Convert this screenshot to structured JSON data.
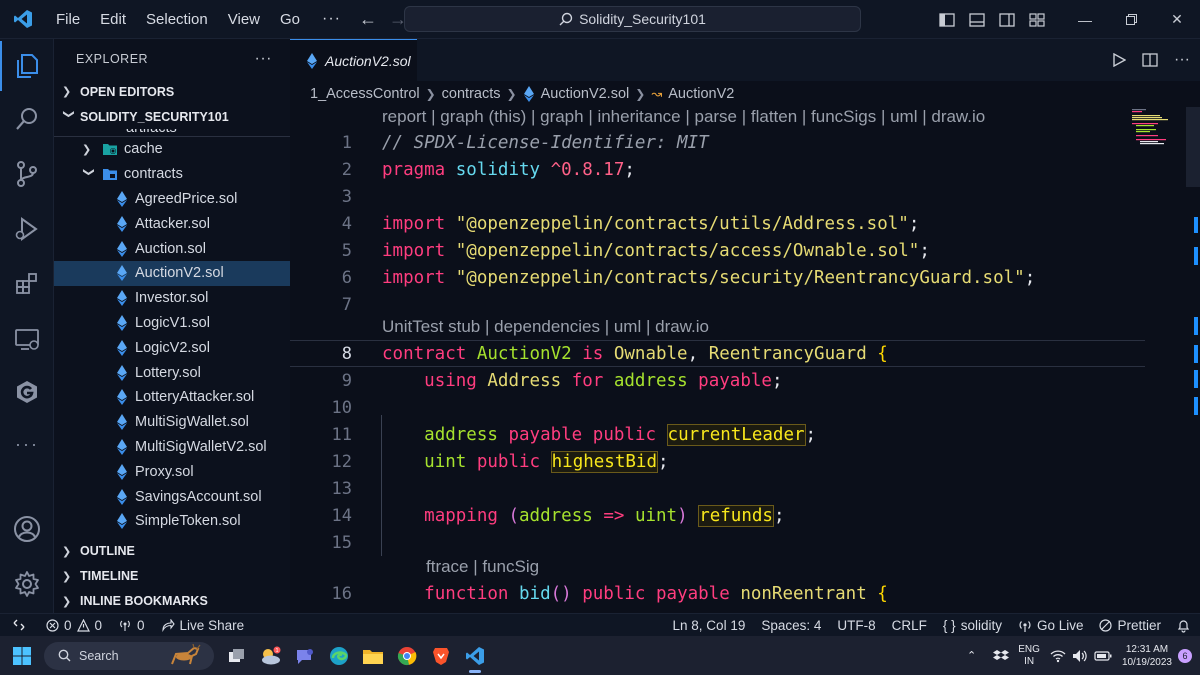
{
  "titlebar": {
    "menu": [
      "File",
      "Edit",
      "Selection",
      "View",
      "Go"
    ],
    "more": "···",
    "search_text": "Solidity_Security101"
  },
  "sidebar": {
    "title": "EXPLORER",
    "more": "···",
    "open_editors": "OPEN EDITORS",
    "project": "SOLIDITY_SECURITY101",
    "partial_folder": "artifacts",
    "folders": [
      {
        "label": "cache",
        "expanded": false
      },
      {
        "label": "contracts",
        "expanded": true
      }
    ],
    "files": [
      "AgreedPrice.sol",
      "Attacker.sol",
      "Auction.sol",
      "AuctionV2.sol",
      "Investor.sol",
      "LogicV1.sol",
      "LogicV2.sol",
      "Lottery.sol",
      "LotteryAttacker.sol",
      "MultiSigWallet.sol",
      "MultiSigWalletV2.sol",
      "Proxy.sol",
      "SavingsAccount.sol",
      "SimpleToken.sol"
    ],
    "selected_file": "AuctionV2.sol",
    "outline": "OUTLINE",
    "timeline": "TIMELINE",
    "bookmarks": "INLINE BOOKMARKS"
  },
  "editor": {
    "tab": "AuctionV2.sol",
    "breadcrumb": [
      "1_AccessControl",
      "contracts",
      "AuctionV2.sol",
      "AuctionV2"
    ],
    "lens_top": "report | graph (this) | graph | inheritance | parse | flatten | funcSigs | uml | draw.io",
    "lens_contract": "UnitTest stub | dependencies | uml | draw.io",
    "lens_func": "ftrace | funcSig",
    "line_numbers": [
      "1",
      "2",
      "3",
      "4",
      "5",
      "6",
      "7",
      "8",
      "9",
      "10",
      "11",
      "12",
      "13",
      "14",
      "15",
      "16"
    ],
    "current_line": "8",
    "code": {
      "l1": "// SPDX-License-Identifier: MIT",
      "l2_kw": "pragma",
      "l2_name": "solidity",
      "l2_ver": "^0.8.17",
      "l2_end": ";",
      "import_kw": "import",
      "l4_str": "\"@openzeppelin/contracts/utils/Address.sol\"",
      "l5_str": "\"@openzeppelin/contracts/access/Ownable.sol\"",
      "l6_str": "\"@openzeppelin/contracts/security/ReentrancyGuard.sol\"",
      "semi": ";",
      "l8_kw": "contract",
      "l8_name": "AuctionV2",
      "l8_is": "is",
      "l8_base1": "Ownable",
      "l8_comma": ",",
      "l8_base2": "ReentrancyGuard",
      "l8_brace": "{",
      "l9_using": "using",
      "l9_lib": "Address",
      "l9_for": "for",
      "l9_type": "address",
      "l9_payable": "payable",
      "l11_type": "address",
      "l11_payable": "payable",
      "l11_public": "public",
      "l11_var": "currentLeader",
      "l12_type": "uint",
      "l12_public": "public",
      "l12_var": "highestBid",
      "l14_mapping": "mapping",
      "l14_open": "(",
      "l14_k": "address",
      "l14_arrow": "=>",
      "l14_v": "uint",
      "l14_close": ")",
      "l14_var": "refunds",
      "l16_fn": "function",
      "l16_name": "bid",
      "l16_parens": "()",
      "l16_public": "public",
      "l16_payable": "payable",
      "l16_mod": "nonReentrant",
      "l16_brace": "{"
    }
  },
  "statusbar": {
    "errors": "0",
    "warnings": "0",
    "ports": "0",
    "live_share": "Live Share",
    "position": "Ln 8, Col 19",
    "spaces": "Spaces: 4",
    "encoding": "UTF-8",
    "eol": "CRLF",
    "language": "solidity",
    "go_live": "Go Live",
    "prettier": "Prettier"
  },
  "taskbar": {
    "search": "Search",
    "weather_badge": "1",
    "lang_top": "ENG",
    "lang_bottom": "IN",
    "time": "12:31 AM",
    "date": "10/19/2023",
    "notif_count": "6"
  },
  "colors": {
    "accent": "#3b8eea",
    "keyword": "#ff3d7f",
    "type": "#a6e22e",
    "string": "#e6db74",
    "selection": "#1a3a5c"
  }
}
